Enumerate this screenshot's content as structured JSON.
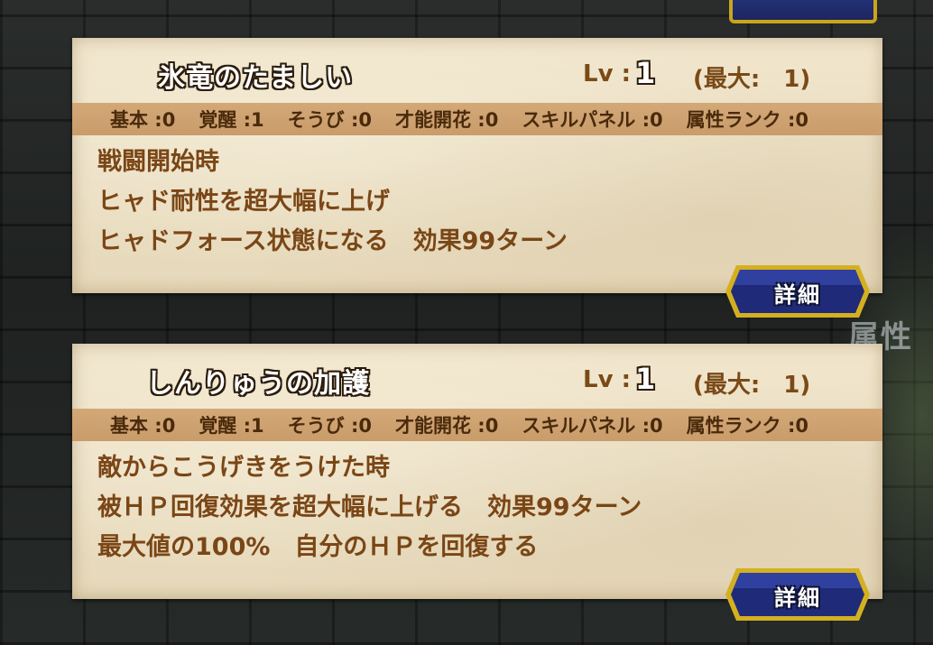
{
  "background": {
    "side_label": "属性"
  },
  "panels": [
    {
      "skill_name": "氷竜のたましい",
      "lv_label": "Lv :",
      "lv_value": "1",
      "lv_max": "(最大:　1)",
      "stats": [
        "基本 :0",
        "覚醒 :1",
        "そうび :0",
        "才能開花 :0",
        "スキルパネル :0",
        "属性ランク :0"
      ],
      "description": [
        "戦闘開始時",
        "ヒャド耐性を超大幅に上げ",
        "ヒャドフォース状態になる　効果99ターン"
      ],
      "detail_button": "詳細"
    },
    {
      "skill_name": "しんりゅうの加護",
      "lv_label": "Lv :",
      "lv_value": "1",
      "lv_max": "(最大:　1)",
      "stats": [
        "基本 :0",
        "覚醒 :1",
        "そうび :0",
        "才能開花 :0",
        "スキルパネル :0",
        "属性ランク :0"
      ],
      "description": [
        "敵からこうげきをうけた時",
        "被ＨＰ回復効果を超大幅に上げる　効果99ターン",
        "最大値の100%　自分のＨＰを回復する"
      ],
      "detail_button": "詳細"
    }
  ],
  "colors": {
    "parchment": "#ebdfc4",
    "stats_bar": "#cfa572",
    "text_brown": "#7a4616",
    "button_blue": "#1f2a78",
    "button_gold": "#d4b021"
  }
}
